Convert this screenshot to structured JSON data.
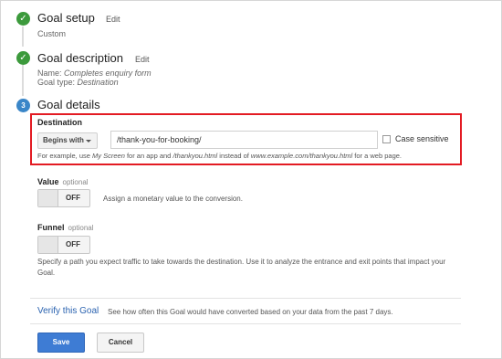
{
  "steps": {
    "setup": {
      "title": "Goal setup",
      "edit": "Edit",
      "subtitle": "Custom"
    },
    "description": {
      "title": "Goal description",
      "edit": "Edit",
      "name_label": "Name:",
      "name_value": "Completes enquiry form",
      "type_label": "Goal type:",
      "type_value": "Destination"
    },
    "details": {
      "number": "3",
      "title": "Goal details"
    }
  },
  "destination": {
    "label": "Destination",
    "match_type": "Begins with",
    "value": "/thank-you-for-booking/",
    "case_sensitive_label": "Case sensitive",
    "case_sensitive_checked": false,
    "hint": {
      "part1": "For example, use ",
      "screen": "My Screen",
      "part2": " for an app and ",
      "url1": "/thankyou.html",
      "part3": " instead of ",
      "url2": "www.example.com/thankyou.html",
      "part4": " for a web page."
    }
  },
  "value_section": {
    "label": "Value",
    "optional": "optional",
    "toggle": "OFF",
    "description": "Assign a monetary value to the conversion."
  },
  "funnel_section": {
    "label": "Funnel",
    "optional": "optional",
    "toggle": "OFF",
    "description_line1": "Specify a path you expect traffic to take towards the destination. Use it to analyze the entrance and exit points that impact your",
    "description_line2": "Goal."
  },
  "verify": {
    "link": "Verify this Goal",
    "description": "See how often this Goal would have converted based on your data from the past 7 days."
  },
  "buttons": {
    "save": "Save",
    "cancel": "Cancel"
  },
  "colors": {
    "check_green": "#3c9a3c",
    "step_blue": "#3a86c8",
    "highlight_red": "#e31b23",
    "save_blue": "#3e7cd4",
    "link_blue": "#2b63b0"
  }
}
